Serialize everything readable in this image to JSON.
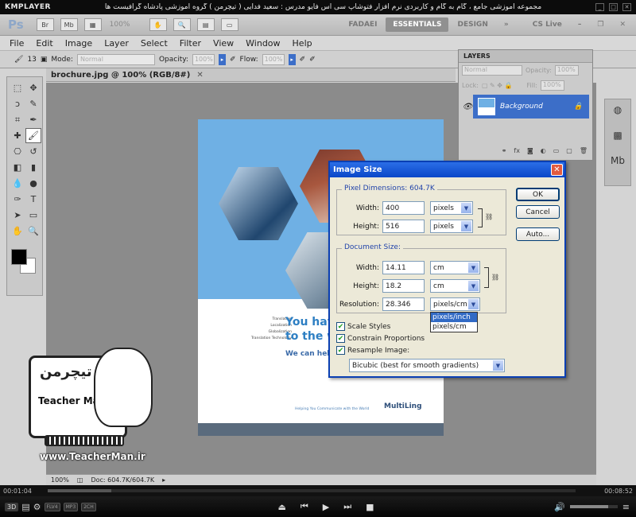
{
  "player": {
    "brand": "KMPLAYER",
    "caption": "مجموعه آموزشی جامع ، گام به گام و کاربردی نرم افزار فتوشاپ سی اس فایو  مدرس : سعید فدایی ( تیچرمن ) گروه آموزشی پادشاه گرافیست ها",
    "time_elapsed": "00:01:04",
    "time_total": "00:08:52",
    "progress": 0.12,
    "volume": 0.8,
    "mode": "3D",
    "tags": [
      "FLV4",
      "MP3",
      "2CH"
    ]
  },
  "photoshop": {
    "logo": "Ps",
    "zoom_readout": "100%",
    "workspaces": [
      "FADAEI",
      "ESSENTIALS",
      "DESIGN"
    ],
    "active_workspace": "ESSENTIALS",
    "cs_live": "CS Live",
    "menu": [
      "File",
      "Edit",
      "Image",
      "Layer",
      "Select",
      "Filter",
      "View",
      "Window",
      "Help"
    ],
    "options": {
      "brush_size": "13",
      "mode_label": "Mode:",
      "mode_value": "Normal",
      "opacity_label": "Opacity:",
      "opacity_value": "100%",
      "flow_label": "Flow:",
      "flow_value": "100%"
    },
    "document_tab": "brochure.jpg @ 100% (RGB/8#)",
    "status": {
      "zoom": "100%",
      "doc": "Doc: 604.7K/604.7K"
    },
    "layers": {
      "tab": "LAYERS",
      "blend": "Normal",
      "opacity_label": "Opacity:",
      "opacity_value": "100%",
      "lock_label": "Lock:",
      "fill_label": "Fill:",
      "fill_value": "100%",
      "layer_name": "Background"
    },
    "brochure": {
      "list": [
        "Translation",
        "Localization",
        "Globalization",
        "Translation Technology"
      ],
      "headline1": "You have",
      "headline2": "to the wo",
      "subline": "We can help yo",
      "tagline": "Helping You Communicate with the World",
      "brand": "MultiLing"
    }
  },
  "dialog": {
    "title": "Image Size",
    "pixel_dimensions_label": "Pixel Dimensions:",
    "pixel_dimensions_value": "604.7K",
    "width_label": "Width:",
    "height_label": "Height:",
    "px_width": "400",
    "px_height": "516",
    "px_unit": "pixels",
    "doc_size_label": "Document Size:",
    "doc_width": "14.11",
    "doc_height": "18.2",
    "doc_unit": "cm",
    "resolution_label": "Resolution:",
    "resolution_value": "28.346",
    "resolution_unit": "pixels/cm",
    "resolution_options": [
      "pixels/inch",
      "pixels/cm"
    ],
    "scale_styles": "Scale Styles",
    "constrain": "Constrain Proportions",
    "resample": "Resample Image:",
    "resample_method": "Bicubic (best for smooth gradients)",
    "ok": "OK",
    "cancel": "Cancel",
    "auto": "Auto..."
  },
  "watermark": {
    "persian": "تیچرمن",
    "name": "Teacher Man",
    "url": "www.TeacherMan.ir"
  }
}
